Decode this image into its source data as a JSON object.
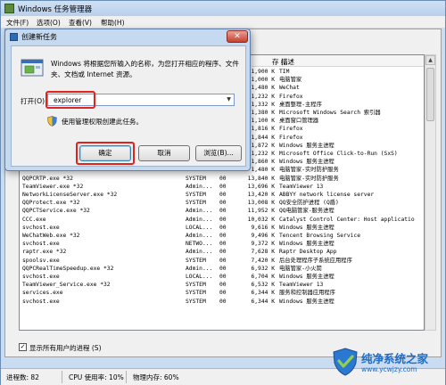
{
  "window": {
    "title": "Windows 任务管理器"
  },
  "menu": [
    {
      "label": "文件(F)"
    },
    {
      "label": "选项(O)"
    },
    {
      "label": "查看(V)"
    },
    {
      "label": "帮助(H)"
    }
  ],
  "table": {
    "headers": {
      "memory_fragment": "存 (...",
      "description": "描述"
    },
    "top_rows": [
      {
        "mem": "1,900 K",
        "desc": "TIM"
      },
      {
        "mem": "1,000 K",
        "desc": "电脑管家"
      },
      {
        "mem": "1,480 K",
        "desc": "WeChat"
      },
      {
        "mem": "1,232 K",
        "desc": "Firefox"
      },
      {
        "mem": "1,332 K",
        "desc": "桌面整理-主程序"
      },
      {
        "mem": "1,380 K",
        "desc": "Microsoft Windows Search 索引器"
      },
      {
        "mem": "1,100 K",
        "desc": "桌面窗口管理器"
      },
      {
        "mem": "1,816 K",
        "desc": "Firefox"
      },
      {
        "mem": "1,844 K",
        "desc": "Firefox"
      },
      {
        "mem": "1,872 K",
        "desc": "Windows 服务主进程"
      },
      {
        "mem": "1,232 K",
        "desc": "Microsoft Office Click-to-Run (SxS)"
      },
      {
        "mem": "1,860 K",
        "desc": "Windows 服务主进程"
      },
      {
        "mem": "1,480 K",
        "desc": "电脑管家-实时防护服务"
      }
    ],
    "rows": [
      {
        "name": "QQPCRTP.exe *32",
        "user": "SYSTEM",
        "cpu": "00",
        "mem": "13,840 K",
        "desc": "电脑管家-实时防护服务"
      },
      {
        "name": "TeamViewer.exe *32",
        "user": "Admin...",
        "cpu": "00",
        "mem": "13,696 K",
        "desc": "TeamViewer 13"
      },
      {
        "name": "NetworkLicenseServer.exe *32",
        "user": "SYSTEM",
        "cpu": "00",
        "mem": "13,420 K",
        "desc": "ABBYY network license server"
      },
      {
        "name": "QQProtect.exe *32",
        "user": "SYSTEM",
        "cpu": "00",
        "mem": "13,008 K",
        "desc": "QQ安全防护进程 (Q盾)"
      },
      {
        "name": "QQPCTService.exe *32",
        "user": "Admin...",
        "cpu": "00",
        "mem": "11,952 K",
        "desc": "QQ电脑管家-服务进程"
      },
      {
        "name": "CCC.exe",
        "user": "Admin...",
        "cpu": "00",
        "mem": "10,032 K",
        "desc": "Catalyst Control Center: Host applicatio"
      },
      {
        "name": "svchost.exe",
        "user": "LOCAL...",
        "cpu": "00",
        "mem": "9,616 K",
        "desc": "Windows 服务主进程"
      },
      {
        "name": "WeChatWeb.exe *32",
        "user": "Admin...",
        "cpu": "00",
        "mem": "9,496 K",
        "desc": "Tencent Browsing Service"
      },
      {
        "name": "svchost.exe",
        "user": "NETWO...",
        "cpu": "00",
        "mem": "9,372 K",
        "desc": "Windows 服务主进程"
      },
      {
        "name": "raptr.exe *32",
        "user": "Admin...",
        "cpu": "00",
        "mem": "7,628 K",
        "desc": "Raptr Desktop App"
      },
      {
        "name": "spoolsv.exe",
        "user": "SYSTEM",
        "cpu": "00",
        "mem": "7,420 K",
        "desc": "后台处理程序子系统应用程序"
      },
      {
        "name": "QQPCRealTimeSpeedup.exe *32",
        "user": "Admin...",
        "cpu": "00",
        "mem": "6,932 K",
        "desc": "电脑管家-小火箭"
      },
      {
        "name": "svchost.exe",
        "user": "LOCAL...",
        "cpu": "00",
        "mem": "6,704 K",
        "desc": "Windows 服务主进程"
      },
      {
        "name": "TeamViewer_Service.exe *32",
        "user": "SYSTEM",
        "cpu": "00",
        "mem": "6,532 K",
        "desc": "TeamViewer 13"
      },
      {
        "name": "services.exe",
        "user": "SYSTEM",
        "cpu": "00",
        "mem": "6,344 K",
        "desc": "服务和控制器应用程序"
      },
      {
        "name": "svchost.exe",
        "user": "SYSTEM",
        "cpu": "00",
        "mem": "6,344 K",
        "desc": "Windows 服务主进程"
      }
    ]
  },
  "show_all": {
    "label": "显示所有用户的进程 (S)",
    "checked": "✓"
  },
  "status": {
    "processes": "进程数: 82",
    "cpu": "CPU 使用率: 10%",
    "memory": "物理内存: 60%"
  },
  "run_dialog": {
    "title": "创建新任务",
    "close_glyph": "✕",
    "description": "Windows 将根据您所输入的名称，为您打开相应的程序、文件夹、文档或 Internet 资源。",
    "open_label": "打开(O):",
    "open_value": "explorer",
    "dropdown_glyph": "▼",
    "admin_note": "使用管理权限创建此任务。",
    "ok_label": "确定",
    "cancel_label": "取消",
    "browse_label": "浏览(B)..."
  },
  "scroll": {
    "up_glyph": "▲"
  },
  "watermark": {
    "title": "纯净系统之家",
    "url": "www.ycwjzy.com"
  },
  "colors": {
    "highlight": "#e0231e",
    "watermark": "#1f6cc4"
  }
}
